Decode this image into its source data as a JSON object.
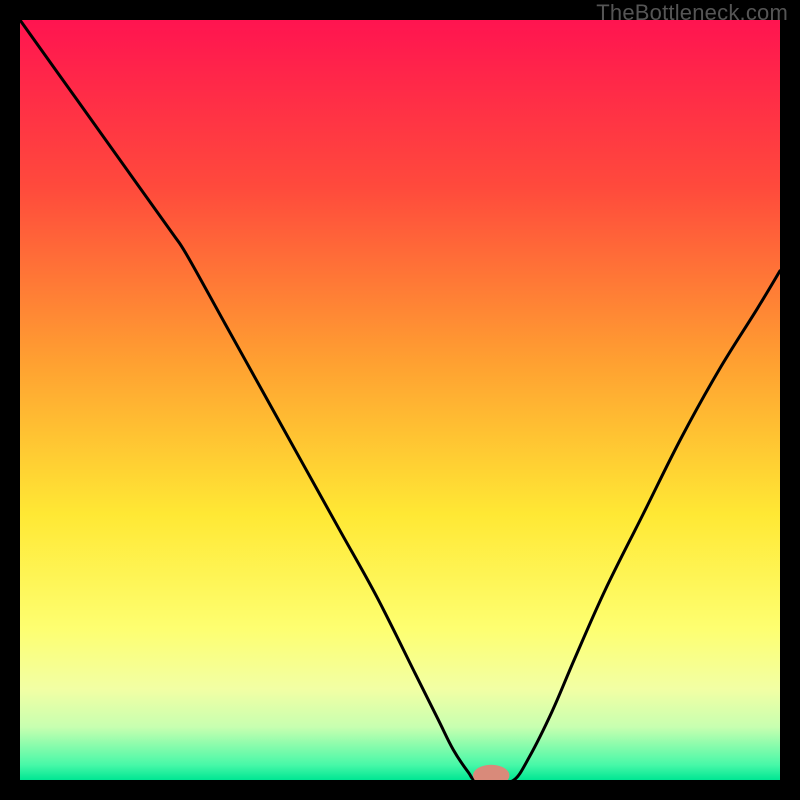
{
  "watermark": "TheBottleneck.com",
  "chart_data": {
    "type": "line",
    "title": "",
    "xlabel": "",
    "ylabel": "",
    "xlim": [
      0,
      100
    ],
    "ylim": [
      0,
      100
    ],
    "grid": false,
    "legend": false,
    "gradient_stops": [
      {
        "offset": 0,
        "color": "#ff1450"
      },
      {
        "offset": 22,
        "color": "#ff4a3c"
      },
      {
        "offset": 45,
        "color": "#ffa031"
      },
      {
        "offset": 65,
        "color": "#ffe834"
      },
      {
        "offset": 80,
        "color": "#feff70"
      },
      {
        "offset": 88,
        "color": "#f2ffa4"
      },
      {
        "offset": 93,
        "color": "#c8ffb0"
      },
      {
        "offset": 98,
        "color": "#48f8a8"
      },
      {
        "offset": 100,
        "color": "#00e693"
      }
    ],
    "series": [
      {
        "name": "bottleneck-curve",
        "color": "#000000",
        "x": [
          0,
          5,
          10,
          15,
          20,
          22,
          27,
          32,
          37,
          42,
          47,
          52,
          55,
          57,
          59,
          60,
          63,
          65,
          67,
          70,
          73,
          77,
          82,
          87,
          92,
          97,
          100
        ],
        "y": [
          100,
          93,
          86,
          79,
          72,
          69,
          60,
          51,
          42,
          33,
          24,
          14,
          8,
          4,
          1,
          0,
          0,
          0,
          3,
          9,
          16,
          25,
          35,
          45,
          54,
          62,
          67
        ]
      }
    ],
    "marker": {
      "x": 62,
      "y": 0.6,
      "rx": 2.4,
      "ry": 1.4,
      "color": "#d98a7a"
    }
  }
}
